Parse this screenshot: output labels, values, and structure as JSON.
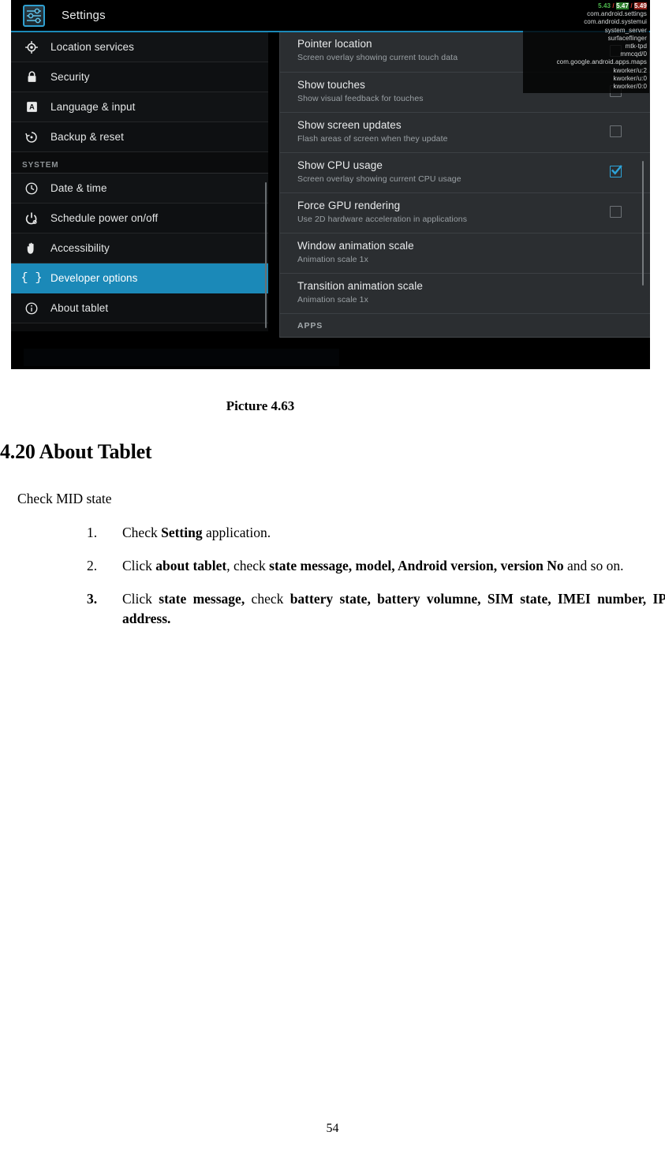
{
  "figure": {
    "caption": "Picture 4.63",
    "android": {
      "action_bar": {
        "title": "Settings",
        "icon": "settings-sliders-icon"
      },
      "accent_color": "#1b89b8",
      "sidebar": {
        "items": [
          {
            "label": "Location services",
            "icon": "location-crosshair-icon",
            "selected": false
          },
          {
            "label": "Security",
            "icon": "lock-icon",
            "selected": false
          },
          {
            "label": "Language & input",
            "icon": "letter-a-icon",
            "selected": false
          },
          {
            "label": "Backup & reset",
            "icon": "backup-restore-icon",
            "selected": false
          }
        ],
        "section_header": "SYSTEM",
        "system_items": [
          {
            "label": "Date & time",
            "icon": "clock-icon",
            "selected": false
          },
          {
            "label": "Schedule power on/off",
            "icon": "power-icon",
            "selected": false
          },
          {
            "label": "Accessibility",
            "icon": "hand-icon",
            "selected": false
          },
          {
            "label": "Developer options",
            "icon": "curly-braces-icon",
            "selected": true
          },
          {
            "label": "About tablet",
            "icon": "info-circle-icon",
            "selected": false
          }
        ]
      },
      "detail": {
        "rows": [
          {
            "title": "Pointer location",
            "subtitle": "Screen overlay showing current touch data",
            "checked": false
          },
          {
            "title": "Show touches",
            "subtitle": "Show visual feedback for touches",
            "checked": false
          },
          {
            "title": "Show screen updates",
            "subtitle": "Flash areas of screen when they update",
            "checked": false
          },
          {
            "title": "Show CPU usage",
            "subtitle": "Screen overlay showing current CPU usage",
            "checked": true
          },
          {
            "title": "Force GPU rendering",
            "subtitle": "Use 2D hardware acceleration in applications",
            "checked": false
          },
          {
            "title": "Window animation scale",
            "subtitle": "Animation scale 1x",
            "checked": null
          },
          {
            "title": "Transition animation scale",
            "subtitle": "Animation scale 1x",
            "checked": null
          }
        ],
        "apps_header": "APPS"
      },
      "cpu_overlay": {
        "load_avg": "5.43 / 5.47 / 5.49",
        "load_parts": [
          "5.43",
          "5.47",
          "5.49"
        ],
        "processes": [
          "com.android.settings",
          "com.android.systemui",
          "system_server",
          "surfaceflinger",
          "mtk-tpd",
          "mmcqd/0",
          "com.google.android.apps.maps",
          "kworker/u:2",
          "kworker/u:0",
          "kworker/0:0"
        ]
      }
    }
  },
  "document": {
    "heading": "4.20 About Tablet",
    "lead": "Check MID state",
    "steps": [
      {
        "num": "1.",
        "bold_num": false,
        "parts": [
          {
            "t": "Check ",
            "b": false
          },
          {
            "t": "Setting",
            "b": true
          },
          {
            "t": " application.",
            "b": false
          }
        ]
      },
      {
        "num": "2.",
        "bold_num": false,
        "parts": [
          {
            "t": "Click ",
            "b": false
          },
          {
            "t": "about tablet",
            "b": true
          },
          {
            "t": ", check ",
            "b": false
          },
          {
            "t": "state message, model, Android version, version No",
            "b": true
          },
          {
            "t": " and so on.",
            "b": false
          }
        ]
      },
      {
        "num": "3.",
        "bold_num": true,
        "parts": [
          {
            "t": "Click ",
            "b": false
          },
          {
            "t": "state message,",
            "b": true
          },
          {
            "t": " check ",
            "b": false
          },
          {
            "t": "battery state, battery volumne, SIM state, IMEI number, IP address.",
            "b": true
          }
        ]
      }
    ],
    "page_number": "54"
  }
}
